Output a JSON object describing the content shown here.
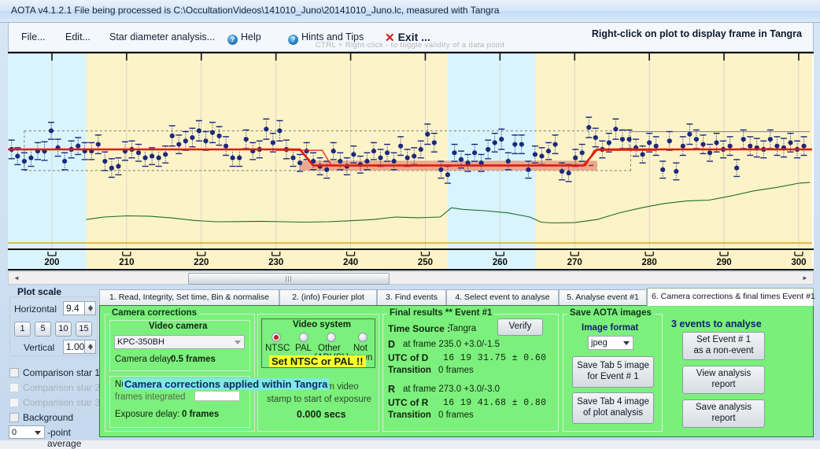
{
  "window": {
    "title": "AOTA v4.1.2.1    File being processed is C:\\OccultationVideos\\141010_Juno\\20141010_Juno.lc, measured with Tangra"
  },
  "menu": {
    "items": [
      {
        "label": "File...",
        "icon": null
      },
      {
        "label": "Edit...",
        "icon": null
      },
      {
        "label": "Star diameter analysis...",
        "icon": null
      },
      {
        "label": "Help",
        "icon": "help-icon"
      },
      {
        "label": "Hints and Tips",
        "icon": "help-icon"
      },
      {
        "label": "Exit ...",
        "icon": "close-icon"
      }
    ],
    "right_hint": "Right-click on plot to display frame in Tangra",
    "ctrl_hint": "CTRL + Right-click  -  to toggle validity of a data point"
  },
  "plot_scale": {
    "title": "Plot scale",
    "horizontal_label": "Horizontal",
    "horizontal_value": "9.4",
    "zoom_buttons": [
      "1",
      "5",
      "10",
      "15"
    ],
    "vertical_label": "Vertical",
    "vertical_value": "1.00",
    "checkboxes": [
      {
        "label": "Comparison star 1",
        "enabled": true,
        "checked": false
      },
      {
        "label": "Comparison star 2",
        "enabled": false,
        "checked": false
      },
      {
        "label": "Comparison star 3",
        "enabled": false,
        "checked": false
      },
      {
        "label": "Background",
        "enabled": true,
        "checked": false
      }
    ],
    "average_value": "0",
    "average_label": "-point average"
  },
  "tabs": [
    {
      "label": "1. Read, Integrity, Set time, Bin & normalise",
      "active": false
    },
    {
      "label": "2. (info)  Fourier plot",
      "active": false
    },
    {
      "label": "3. Find events",
      "active": false
    },
    {
      "label": "4. Select event to analyse",
      "active": false
    },
    {
      "label": "5. Analyse event #1",
      "active": false
    },
    {
      "label": "6. Camera corrections & final times Event #1",
      "active": true
    }
  ],
  "camera_corrections": {
    "legend": "Camera corrections",
    "video_camera_title": "Video camera",
    "video_camera_value": "KPC-350BH",
    "camera_delay_label": "Camera delay:",
    "camera_delay_value": "0.5 frames",
    "num_frames_label": "Nur",
    "frames_integrated_label": "frames integrated",
    "frames_integrated_value": "",
    "exposure_delay_label": "Exposure delay:",
    "exposure_delay_value": "0 frames",
    "overlay_banner": "Camera corrections applied within Tangra",
    "overlay_tail_1": "from video",
    "overlay_tail_2": "stamp to start of exposure",
    "overlay_secs": "0.000 secs"
  },
  "video_system": {
    "title": "Video system",
    "options": [
      {
        "label": "NTSC",
        "sublabel": "",
        "selected": true
      },
      {
        "label": "PAL",
        "sublabel": "",
        "selected": false
      },
      {
        "label": "Other",
        "sublabel": "(ADVS)",
        "selected": false
      },
      {
        "label": "Not",
        "sublabel": "known",
        "selected": false
      }
    ],
    "warning": "Set NTSC or PAL !!"
  },
  "final_results": {
    "legend": "Final results  **  Event #1",
    "time_source_label": "Time Source :",
    "time_source_value": "Tangra",
    "verify_button": "Verify",
    "d_label": "D",
    "d_frame_text": "at frame 235.0  +3.0/-1.5",
    "d_utc_label": "UTC of D",
    "d_utc_value": "16 19 31.75  ± 0.60",
    "d_transition_label": "Transition",
    "d_transition_value": "0 frames",
    "r_label": "R",
    "r_frame_text": "at frame 273.0  +3.0/-3.0",
    "r_utc_label": "UTC of R",
    "r_utc_value": "16 19 41.68  ± 0.80",
    "r_transition_label": "Transition",
    "r_transition_value": "0 frames"
  },
  "save_images": {
    "legend": "Save AOTA images",
    "format_label": "Image format",
    "format_value": "jpeg",
    "save_tab5_line1": "Save Tab 5 image",
    "save_tab5_line2": "for Event # 1",
    "save_tab4_line1": "Save Tab 4 image",
    "save_tab4_line2": "of plot analysis"
  },
  "events_panel": {
    "heading": "3  events to analyse",
    "non_event_line1": "Set Event # 1",
    "non_event_line2": "as a non-event",
    "view_report_line1": "View analysis",
    "view_report_line2": "report",
    "save_report_line1": "Save analysis",
    "save_report_line2": "report"
  },
  "scrollbar": {
    "left_arrow": "◄",
    "right_arrow": "►",
    "grip": "|||"
  },
  "chart_data": {
    "type": "scatter",
    "title": "",
    "xlabel": "",
    "ylabel": "",
    "xlim": [
      194.1,
      301.8
    ],
    "ylim": [
      0,
      1.55
    ],
    "grid": true,
    "xticks": [
      200,
      210,
      220,
      230,
      240,
      250,
      260,
      270,
      280,
      290,
      300
    ],
    "colors": {
      "point": "#1b2a7a",
      "fit": "#e21b0c",
      "background_curve": "#1c6b2e",
      "band_blue": "#d9f4fd",
      "band_yellow": "#fdf3c8",
      "baseline_guide": "#7a7a7a",
      "bottom_rule": "#e0a820",
      "event_band": "#e59c82"
    },
    "bands": [
      {
        "from": 194.1,
        "to": 204.6,
        "color": "blue"
      },
      {
        "from": 204.6,
        "to": 253.0,
        "color": "yellow"
      },
      {
        "from": 253.0,
        "to": 264.8,
        "color": "blue"
      },
      {
        "from": 264.8,
        "to": 301.8,
        "color": "yellow"
      }
    ],
    "fit_curve": {
      "comment": "step light-curve model: full level before D, occulted level between D and R",
      "full_level": 1.0,
      "occulted_level": 0.905,
      "d_frame": 235.0,
      "r_frame": 273.0,
      "d_transition": [
        233.2,
        235.0
      ],
      "r_transition": [
        271.2,
        273.0
      ]
    },
    "guides": {
      "upper_dashed": 1.11,
      "lower_dashed": 0.875,
      "solid_right": 1.105
    },
    "series": [
      {
        "name": "target star flux",
        "x": [
          194.6,
          195.4,
          196.3,
          197.2,
          198.1,
          199.0,
          199.9,
          200.8,
          201.7,
          202.6,
          203.5,
          204.4,
          205.3,
          206.2,
          207.1,
          208.0,
          208.9,
          209.8,
          210.7,
          211.6,
          212.5,
          213.4,
          214.3,
          215.2,
          216.1,
          217.0,
          217.9,
          218.8,
          219.7,
          220.6,
          221.5,
          222.4,
          223.3,
          224.2,
          225.1,
          226.0,
          226.9,
          227.8,
          228.7,
          229.6,
          230.5,
          231.4,
          232.3,
          233.2,
          234.1,
          235.0,
          235.9,
          236.8,
          237.7,
          238.6,
          239.5,
          240.4,
          241.3,
          242.2,
          243.1,
          244.0,
          244.9,
          245.8,
          246.7,
          247.6,
          248.5,
          249.4,
          250.3,
          251.2,
          252.1,
          253.0,
          253.9,
          254.8,
          255.7,
          256.6,
          257.5,
          258.4,
          259.3,
          260.2,
          261.1,
          262.0,
          262.9,
          263.8,
          264.7,
          265.6,
          266.5,
          267.4,
          268.3,
          269.2,
          270.1,
          271.0,
          271.9,
          272.8,
          273.7,
          274.6,
          275.5,
          276.4,
          277.3,
          278.2,
          279.1,
          280.0,
          280.9,
          281.8,
          282.7,
          283.6,
          284.5,
          285.4,
          286.3,
          287.2,
          288.1,
          289.0,
          289.9,
          290.8,
          291.7,
          292.6,
          293.5,
          294.4,
          295.3,
          296.2,
          297.1,
          298.0,
          298.9,
          299.8,
          300.7
        ],
        "y": [
          1.0,
          0.96,
          0.93,
          0.95,
          0.99,
          0.99,
          1.11,
          1.01,
          0.93,
          1.0,
          1.02,
          0.99,
          0.99,
          1.03,
          0.93,
          0.89,
          0.9,
          0.99,
          1.0,
          0.98,
          0.95,
          0.96,
          0.95,
          0.97,
          1.08,
          1.03,
          1.05,
          1.07,
          1.11,
          1.05,
          1.1,
          1.08,
          1.02,
          0.95,
          0.95,
          1.06,
          0.99,
          1.0,
          1.12,
          1.04,
          1.11,
          1.0,
          0.95,
          0.92,
          0.99,
          0.93,
          0.9,
          0.88,
          0.99,
          0.93,
          0.9,
          0.97,
          0.91,
          0.93,
          0.99,
          0.95,
          0.98,
          0.93,
          1.02,
          0.95,
          0.96,
          1.0,
          1.09,
          1.04,
          0.88,
          0.85,
          0.98,
          0.94,
          0.92,
          0.98,
          0.92,
          1.0,
          1.04,
          1.06,
          0.93,
          1.03,
          1.03,
          0.88,
          0.97,
          0.96,
          0.99,
          1.03,
          0.87,
          0.86,
          0.95,
          0.98,
          1.13,
          1.07,
          1.0,
          1.04,
          1.12,
          1.06,
          1.06,
          1.01,
          0.97,
          1.04,
          1.02,
          0.88,
          1.05,
          0.87,
          1.02,
          1.09,
          1.06,
          1.03,
          0.98,
          1.04,
          1.0,
          1.02,
          0.89,
          1.06,
          1.02,
          1.01,
          1.0,
          1.06,
          1.02,
          1.01,
          1.04,
          1.0,
          1.02
        ],
        "yerr": [
          0.055,
          0.05,
          0.05,
          0.05,
          0.05,
          0.055,
          0.05,
          0.05,
          0.05,
          0.05,
          0.05,
          0.05,
          0.05,
          0.055,
          0.055,
          0.055,
          0.05,
          0.055,
          0.05,
          0.05,
          0.05,
          0.05,
          0.05,
          0.05,
          0.06,
          0.055,
          0.055,
          0.055,
          0.06,
          0.055,
          0.06,
          0.055,
          0.055,
          0.05,
          0.05,
          0.055,
          0.05,
          0.05,
          0.06,
          0.055,
          0.06,
          0.055,
          0.05,
          0.05,
          0.05,
          0.05,
          0.05,
          0.05,
          0.05,
          0.05,
          0.05,
          0.05,
          0.05,
          0.05,
          0.05,
          0.05,
          0.05,
          0.05,
          0.055,
          0.05,
          0.05,
          0.05,
          0.06,
          0.055,
          0.05,
          0.05,
          0.05,
          0.05,
          0.05,
          0.05,
          0.05,
          0.055,
          0.055,
          0.06,
          0.05,
          0.055,
          0.055,
          0.05,
          0.05,
          0.05,
          0.05,
          0.055,
          0.05,
          0.05,
          0.05,
          0.05,
          0.06,
          0.055,
          0.05,
          0.055,
          0.06,
          0.055,
          0.055,
          0.05,
          0.05,
          0.055,
          0.055,
          0.05,
          0.055,
          0.05,
          0.055,
          0.06,
          0.055,
          0.055,
          0.05,
          0.055,
          0.05,
          0.055,
          0.05,
          0.055,
          0.055,
          0.055,
          0.05,
          0.055,
          0.055,
          0.055,
          0.055,
          0.05,
          0.055
        ]
      },
      {
        "name": "background level",
        "x": [
          204.6,
          207,
          210,
          213,
          216,
          219,
          222,
          225,
          228,
          231,
          234,
          237,
          240,
          243,
          246,
          249,
          252,
          253.5,
          255,
          258,
          261,
          264,
          265.5,
          267,
          270,
          273,
          276,
          279,
          282,
          285,
          288,
          291,
          294,
          297,
          300,
          301.5
        ],
        "y": [
          0.585,
          0.6,
          0.607,
          0.605,
          0.595,
          0.58,
          0.572,
          0.573,
          0.575,
          0.572,
          0.57,
          0.572,
          0.578,
          0.585,
          0.6,
          0.596,
          0.6,
          0.655,
          0.645,
          0.637,
          0.625,
          0.6,
          0.57,
          0.565,
          0.567,
          0.585,
          0.625,
          0.655,
          0.68,
          0.695,
          0.7,
          0.725,
          0.755,
          0.775,
          0.8,
          0.805
        ]
      }
    ]
  }
}
